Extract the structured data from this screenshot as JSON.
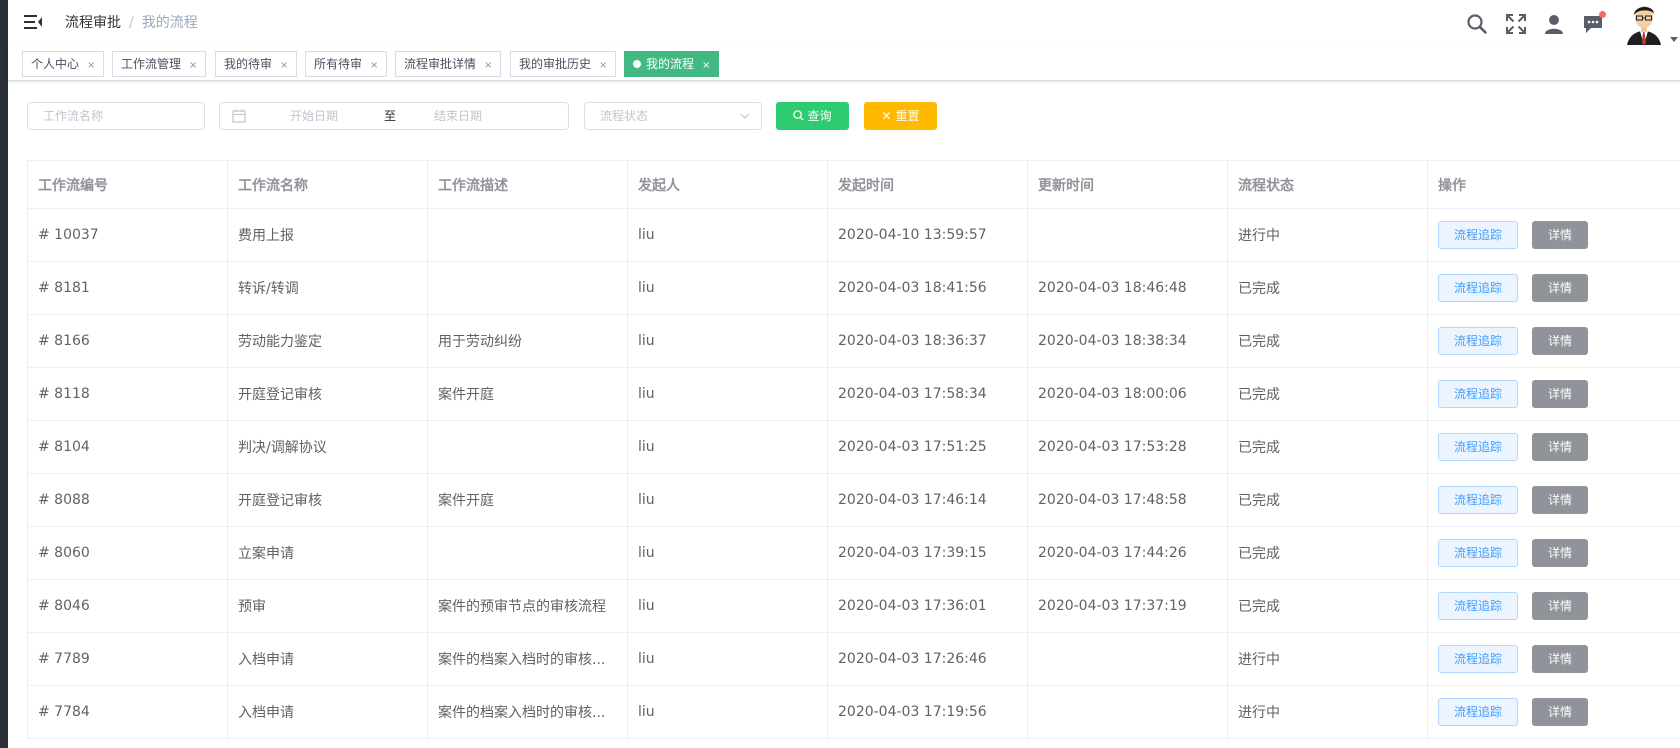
{
  "navbar": {
    "breadcrumb": [
      "流程审批",
      "我的流程"
    ],
    "icons": [
      "search-icon",
      "fullscreen-icon",
      "user-icon",
      "message-icon"
    ],
    "avatar": "avatar"
  },
  "tags": [
    {
      "label": "个人中心",
      "active": false
    },
    {
      "label": "工作流管理",
      "active": false
    },
    {
      "label": "我的待审",
      "active": false
    },
    {
      "label": "所有待审",
      "active": false
    },
    {
      "label": "流程审批详情",
      "active": false
    },
    {
      "label": "我的审批历史",
      "active": false
    },
    {
      "label": "我的流程",
      "active": true
    }
  ],
  "filter": {
    "name_placeholder": "工作流名称",
    "start_placeholder": "开始日期",
    "range_sep": "至",
    "end_placeholder": "结束日期",
    "status_placeholder": "流程状态",
    "query_label": "查询",
    "reset_label": "重置"
  },
  "table": {
    "columns": [
      "工作流编号",
      "工作流名称",
      "工作流描述",
      "发起人",
      "发起时间",
      "更新时间",
      "流程状态",
      "操作"
    ],
    "trace_label": "流程追踪",
    "detail_label": "详情",
    "rows": [
      {
        "id": "# 10037",
        "name": "费用上报",
        "desc": "",
        "initiator": "liu",
        "start": "2020-04-10 13:59:57",
        "update": "",
        "status": "进行中"
      },
      {
        "id": "# 8181",
        "name": "转诉/转调",
        "desc": "",
        "initiator": "liu",
        "start": "2020-04-03 18:41:56",
        "update": "2020-04-03 18:46:48",
        "status": "已完成"
      },
      {
        "id": "# 8166",
        "name": "劳动能力鉴定",
        "desc": "用于劳动纠纷",
        "initiator": "liu",
        "start": "2020-04-03 18:36:37",
        "update": "2020-04-03 18:38:34",
        "status": "已完成"
      },
      {
        "id": "# 8118",
        "name": "开庭登记审核",
        "desc": "案件开庭",
        "initiator": "liu",
        "start": "2020-04-03 17:58:34",
        "update": "2020-04-03 18:00:06",
        "status": "已完成"
      },
      {
        "id": "# 8104",
        "name": "判决/调解协议",
        "desc": "",
        "initiator": "liu",
        "start": "2020-04-03 17:51:25",
        "update": "2020-04-03 17:53:28",
        "status": "已完成"
      },
      {
        "id": "# 8088",
        "name": "开庭登记审核",
        "desc": "案件开庭",
        "initiator": "liu",
        "start": "2020-04-03 17:46:14",
        "update": "2020-04-03 17:48:58",
        "status": "已完成"
      },
      {
        "id": "# 8060",
        "name": "立案申请",
        "desc": "",
        "initiator": "liu",
        "start": "2020-04-03 17:39:15",
        "update": "2020-04-03 17:44:26",
        "status": "已完成"
      },
      {
        "id": "# 8046",
        "name": "预审",
        "desc": "案件的预审节点的审核流程",
        "initiator": "liu",
        "start": "2020-04-03 17:36:01",
        "update": "2020-04-03 17:37:19",
        "status": "已完成"
      },
      {
        "id": "# 7789",
        "name": "入档申请",
        "desc": "案件的档案入档时的审核...",
        "initiator": "liu",
        "start": "2020-04-03 17:26:46",
        "update": "",
        "status": "进行中"
      },
      {
        "id": "# 7784",
        "name": "入档申请",
        "desc": "案件的档案入档时的审核...",
        "initiator": "liu",
        "start": "2020-04-03 17:19:56",
        "update": "",
        "status": "进行中"
      }
    ]
  }
}
